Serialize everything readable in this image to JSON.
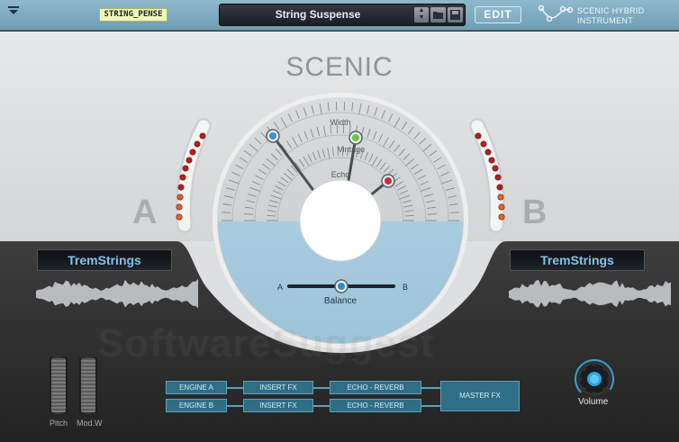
{
  "header": {
    "patch_tag": "STRING_PENSE",
    "preset_name": "String Suspense",
    "edit_label": "EDIT",
    "logo_line1": "SCENIC HYBRID",
    "logo_line2": "INSTRUMENT",
    "icons": [
      "menu-arrow-icon",
      "up-down-arrows-icon",
      "folder-icon",
      "save-icon",
      "scenic-logo-icon"
    ]
  },
  "main": {
    "title": "SCENIC",
    "letter_a": "A",
    "letter_b": "B",
    "dial": {
      "labels": [
        "Width",
        "Vintage",
        "Echo"
      ],
      "balance_label": "Balance",
      "balance_a": "A",
      "balance_b": "B",
      "colors": {
        "width_knob": "#3b8fd4",
        "vintage_knob": "#5fc93a",
        "echo_knob": "#d12a3a",
        "water": "#a9ccdf"
      }
    },
    "slot_a": "TremStrings",
    "slot_b": "TremStrings"
  },
  "bottom": {
    "pitch_label": "Pitch",
    "mod_label": "Mod.W",
    "fx": {
      "engine_a": "ENGINE A",
      "engine_b": "ENGINE B",
      "insert_a": "INSERT FX",
      "insert_b": "INSERT FX",
      "echo_a": "ECHO - REVERB",
      "echo_b": "ECHO - REVERB",
      "master": "MASTER FX"
    },
    "volume_label": "Volume"
  },
  "watermark": "SoftwareSuggest"
}
